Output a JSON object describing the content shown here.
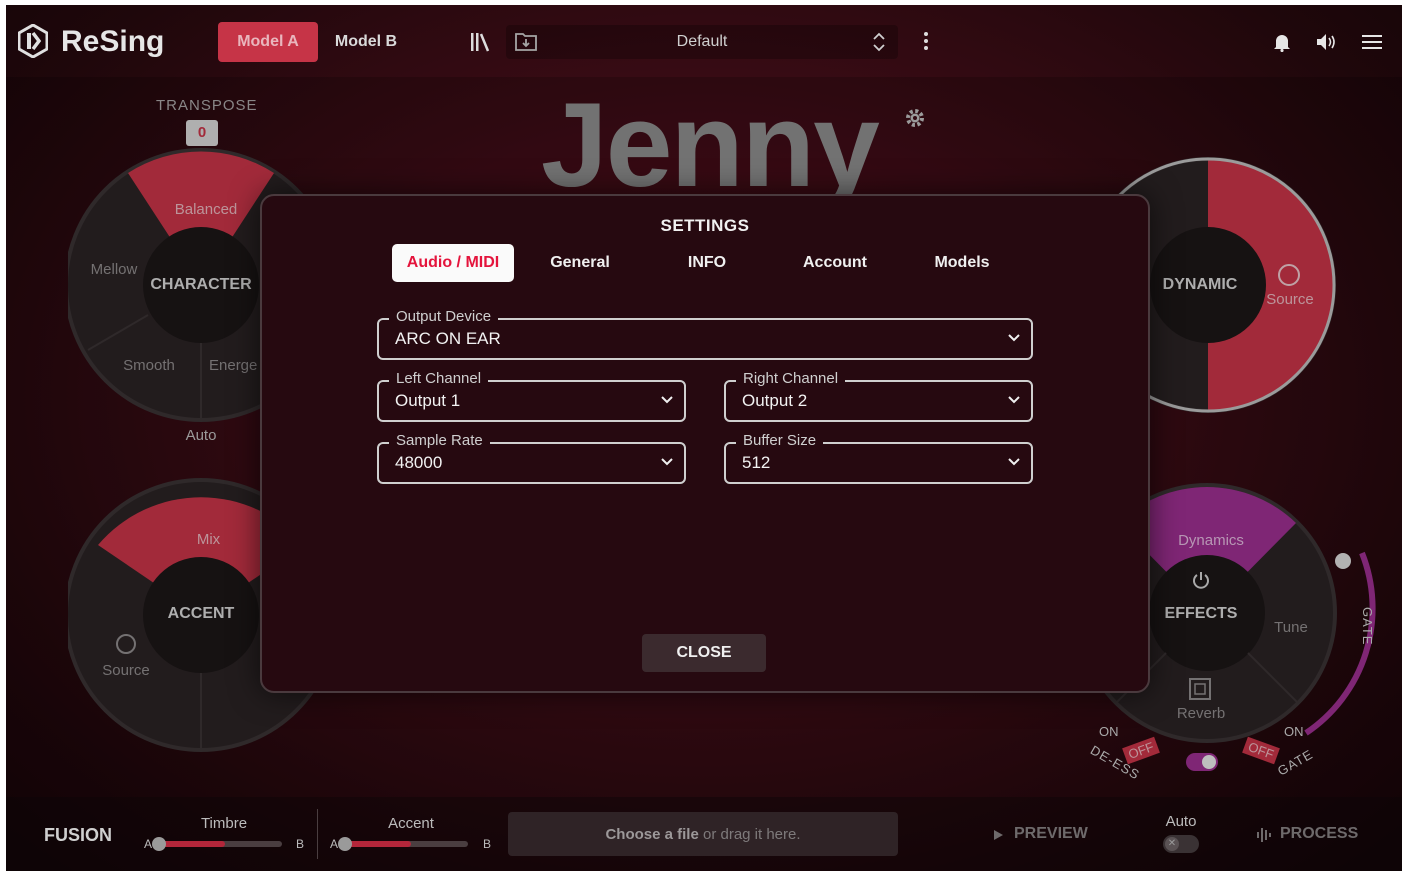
{
  "app": {
    "name": "ReSing",
    "voice_name": "Jenny"
  },
  "topbar": {
    "model_a": "Model A",
    "model_b": "Model B",
    "preset": "Default",
    "icons": [
      "library-icon",
      "save-preset-icon",
      "updown-arrows-icon",
      "kebab-menu-icon",
      "bell-icon",
      "speaker-icon",
      "hamburger-menu-icon"
    ]
  },
  "transpose": {
    "label": "TRANSPOSE",
    "value": "0"
  },
  "character": {
    "center": "CHARACTER",
    "balanced": "Balanced",
    "mellow": "Mellow",
    "smooth": "Smooth",
    "energetic": "Energe",
    "auto": "Auto"
  },
  "accent": {
    "center": "ACCENT",
    "mix": "Mix",
    "source": "Source"
  },
  "dynamic": {
    "center": "DYNAMIC",
    "source": "Source"
  },
  "effects": {
    "center": "EFFECTS",
    "dynamics": "Dynamics",
    "tune": "Tune",
    "reverb": "Reverb",
    "gate": "GATE",
    "on_left": "ON",
    "off_left": "OFF",
    "deess": "DE-ESS",
    "on_right": "ON",
    "off_right": "OFF",
    "gate_arc": "GATE"
  },
  "settings": {
    "title": "SETTINGS",
    "tabs": [
      "Audio / MIDI",
      "General",
      "INFO",
      "Account",
      "Models"
    ],
    "active_tab": "Audio / MIDI",
    "output_device": {
      "label": "Output Device",
      "value": "ARC ON EAR"
    },
    "left_channel": {
      "label": "Left Channel",
      "value": "Output 1"
    },
    "right_channel": {
      "label": "Right Channel",
      "value": "Output 2"
    },
    "sample_rate": {
      "label": "Sample Rate",
      "value": "48000"
    },
    "buffer_size": {
      "label": "Buffer Size",
      "value": "512"
    },
    "close": "CLOSE"
  },
  "bottombar": {
    "fusion": "FUSION",
    "timbre": {
      "label": "Timbre",
      "a": "A",
      "b": "B"
    },
    "accent": {
      "label": "Accent",
      "a": "A",
      "b": "B"
    },
    "dropzone_bold": "Choose a file",
    "dropzone_rest": " or drag it here.",
    "preview": "PREVIEW",
    "auto": "Auto",
    "process": "PROCESS"
  },
  "colors": {
    "accent_red": "#c63447",
    "tab_active_text": "#e4143c",
    "effects_purple": "#9b2f8f"
  }
}
